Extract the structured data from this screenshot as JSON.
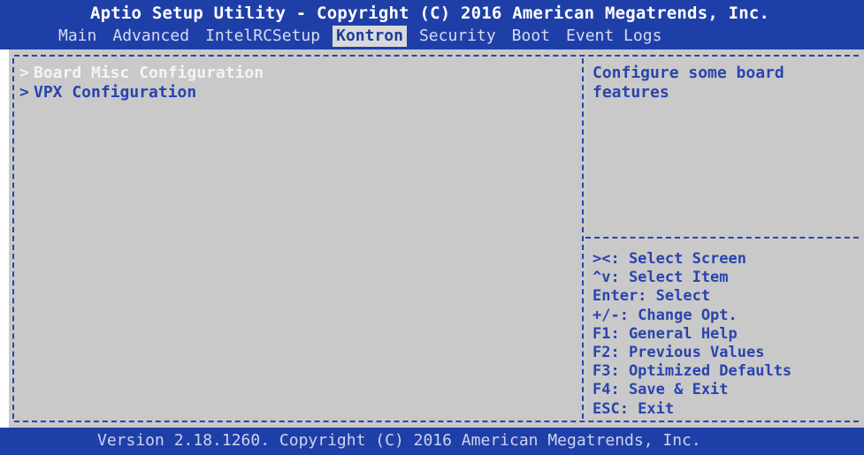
{
  "header": {
    "title": "Aptio Setup Utility - Copyright (C) 2016 American Megatrends, Inc.",
    "tabs": [
      {
        "label": "Main"
      },
      {
        "label": "Advanced"
      },
      {
        "label": "IntelRCSetup"
      },
      {
        "label": "Kontron",
        "active": true
      },
      {
        "label": "Security"
      },
      {
        "label": "Boot"
      },
      {
        "label": "Event Logs"
      }
    ]
  },
  "menu": {
    "items": [
      {
        "chevron": ">",
        "label": "Board Misc Configuration",
        "selected": true
      },
      {
        "chevron": ">",
        "label": "VPX Configuration",
        "selected": false
      }
    ]
  },
  "help": {
    "lines": [
      "Configure some board",
      "features"
    ]
  },
  "keys": {
    "lines": [
      "><: Select Screen",
      "^v: Select Item",
      "Enter: Select",
      "+/-: Change Opt.",
      "F1: General Help",
      "F2: Previous Values",
      "F3: Optimized Defaults",
      "F4: Save & Exit",
      "ESC: Exit"
    ]
  },
  "footer": {
    "text": "Version 2.18.1260. Copyright (C) 2016 American Megatrends, Inc."
  },
  "colors": {
    "bar_blue": "#1f3fa8",
    "panel_gray": "#c9c9c9",
    "text_blue": "#2a44ae",
    "selected_text": "#f4f4f4"
  }
}
